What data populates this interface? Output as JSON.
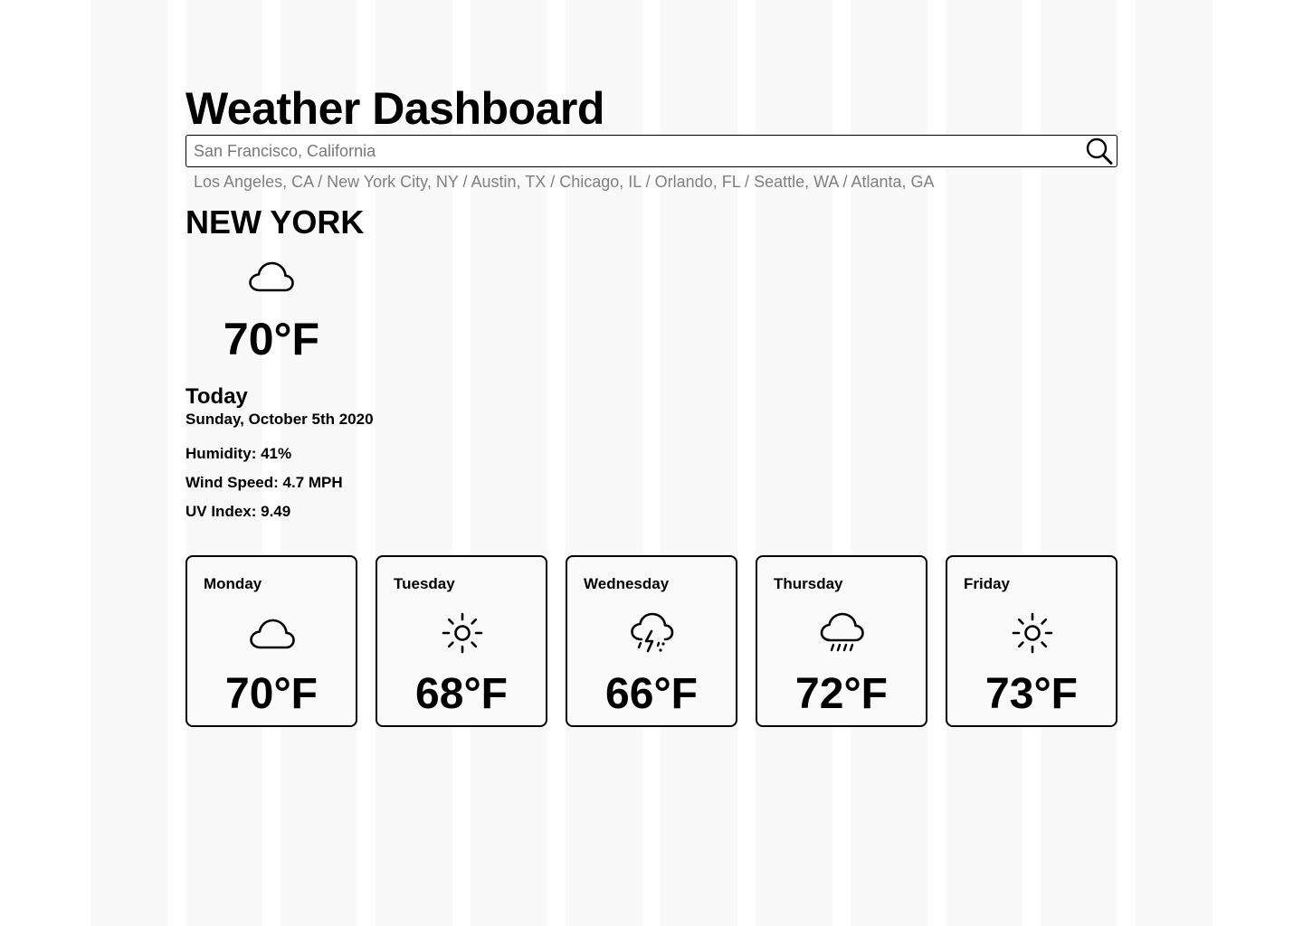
{
  "header": {
    "title": "Weather Dashboard"
  },
  "search": {
    "placeholder": "San Francisco, California",
    "icon": "search-icon"
  },
  "recent_cities": [
    "Los Angeles, CA",
    "New York City, NY",
    "Austin, TX",
    "Chicago, IL",
    "Orlando, FL",
    "Seattle, WA",
    "Atlanta, GA"
  ],
  "recent_separator": " / ",
  "current": {
    "city": "NEW YORK",
    "icon": "cloud-icon",
    "temp": "70°F",
    "day_label": "Today",
    "date": "Sunday, October 5th 2020",
    "humidity": "Humidity: 41%",
    "wind_speed": "Wind Speed: 4.7 MPH",
    "uv_index": "UV Index: 9.49"
  },
  "forecast": [
    {
      "day": "Monday",
      "icon": "cloud-icon",
      "temp": "70°F"
    },
    {
      "day": "Tuesday",
      "icon": "sun-icon",
      "temp": "68°F"
    },
    {
      "day": "Wednesday",
      "icon": "thunderstorm-icon",
      "temp": "66°F"
    },
    {
      "day": "Thursday",
      "icon": "rain-icon",
      "temp": "72°F"
    },
    {
      "day": "Friday",
      "icon": "sun-icon",
      "temp": "73°F"
    }
  ],
  "colors": {
    "text": "#000000",
    "muted": "#808080",
    "grid_column": "#f9f9f9",
    "card_background": "#fafafa"
  }
}
